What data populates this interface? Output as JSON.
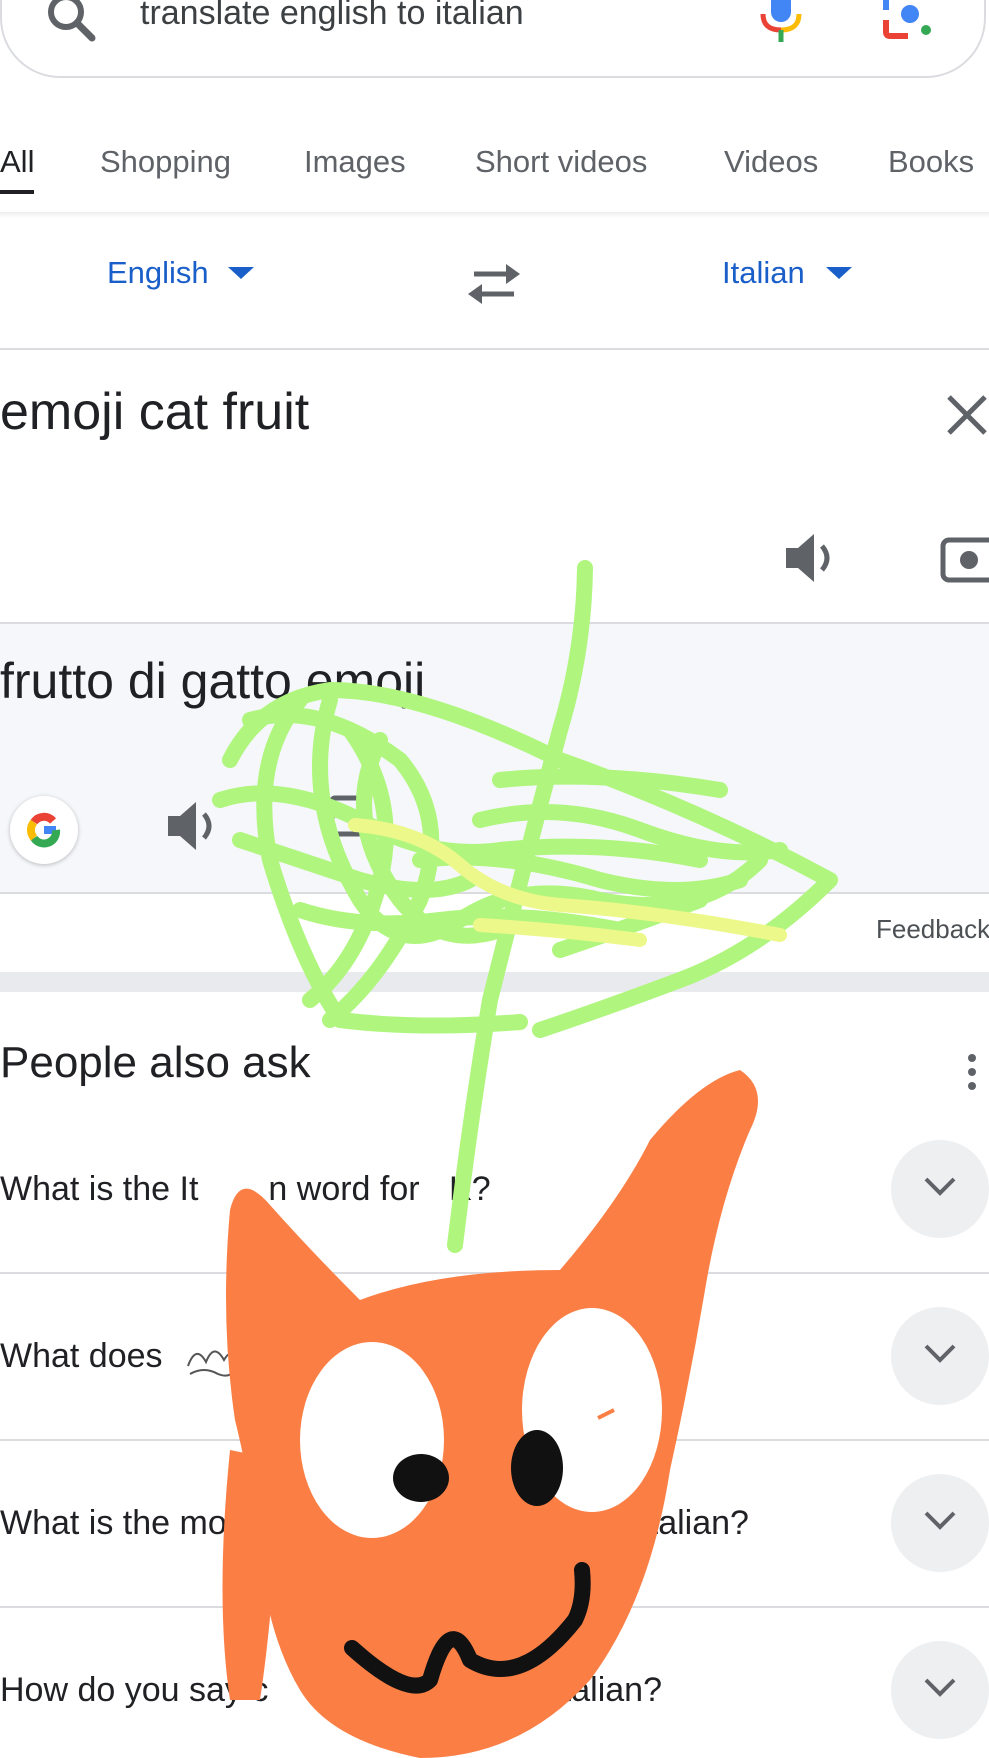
{
  "search": {
    "query": "translate english to italian"
  },
  "tabs": [
    {
      "label": "All",
      "active": true
    },
    {
      "label": "Shopping",
      "active": false
    },
    {
      "label": "Images",
      "active": false
    },
    {
      "label": "Short videos",
      "active": false
    },
    {
      "label": "Videos",
      "active": false
    },
    {
      "label": "Books",
      "active": false
    }
  ],
  "translator": {
    "source_language": "English",
    "target_language": "Italian",
    "source_text": "emoji cat fruit",
    "target_text": "frutto di gatto emoji",
    "feedback": "Feedback"
  },
  "people_also_ask": {
    "title": "People also ask",
    "questions": [
      {
        "parts": [
          "What is the It",
          "n word for ",
          "K?"
        ]
      },
      {
        "parts": [
          "What does ",
          ""
        ]
      },
      {
        "parts": [
          "What is the mo",
          "talian?"
        ]
      },
      {
        "parts": [
          "How do you say c",
          "Italian?"
        ]
      }
    ]
  },
  "colors": {
    "accent_blue": "#1a5fc9",
    "doodle_green": "#b0f67e",
    "doodle_yellow": "#edf88a",
    "doodle_orange": "#fb7f45"
  },
  "icons": [
    "search-icon",
    "mic-icon",
    "lens-icon",
    "swap-icon",
    "close-icon",
    "speaker-icon",
    "camera-icon",
    "google-logo",
    "more-vert-icon",
    "chevron-down-icon"
  ]
}
